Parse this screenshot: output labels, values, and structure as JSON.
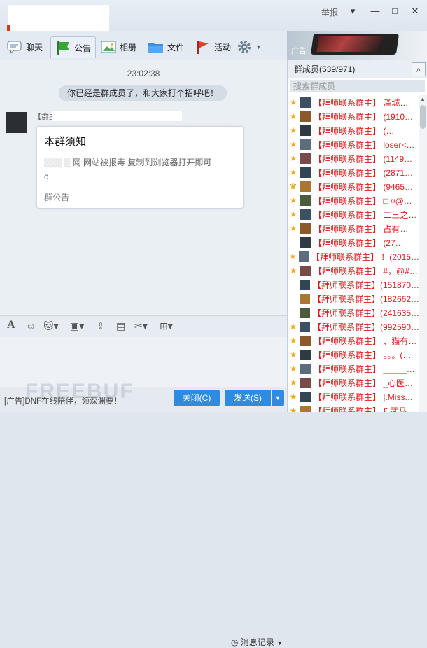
{
  "window": {
    "report_label": "举报",
    "controls": [
      "▾",
      "—",
      "□",
      "✕"
    ]
  },
  "tabs": [
    {
      "label": "聊天",
      "icon": "chat-bubble-icon"
    },
    {
      "label": "公告",
      "icon": "flag-icon",
      "active": true
    },
    {
      "label": "相册",
      "icon": "photo-icon"
    },
    {
      "label": "文件",
      "icon": "folder-icon"
    },
    {
      "label": "活动",
      "icon": "event-flag-icon"
    }
  ],
  "ad_top": {
    "label": "广告"
  },
  "chat": {
    "timestamp": "23:02:38",
    "system_message": "你已经是群成员了，和大家打个招呼吧！",
    "sender_prefix": "【群主",
    "card": {
      "title": "本群须知",
      "line1": "网 网站被报毒 复制到浏览器打开即可",
      "line2": "c              .com",
      "footer": "群公告"
    }
  },
  "input_toolbar": {
    "history_label": "消息记录"
  },
  "bottom": {
    "ad_text": "[广告]DNF在线陪伴，领深渊要！",
    "close_button": "关闭(C)",
    "send_button": "发送(S)"
  },
  "members": {
    "header": "群成员(539/971)",
    "search_placeholder": "搜索群成员",
    "items": [
      {
        "role": "star",
        "name": "【拜师联系群主】  泽城…"
      },
      {
        "role": "star",
        "name": "【拜师联系群主】  (1910…"
      },
      {
        "role": "star",
        "name": "【拜师联系群主】       (…"
      },
      {
        "role": "star",
        "name": "【拜师联系群主】  loser<…"
      },
      {
        "role": "star",
        "name": "【拜师联系群主】  (1149…"
      },
      {
        "role": "star",
        "name": "【拜师联系群主】  (2871…"
      },
      {
        "role": "crown",
        "name": "【拜师联系群主】  (9465…"
      },
      {
        "role": "star",
        "name": "【拜师联系群主】  □ ¤@…"
      },
      {
        "role": "star",
        "name": "【拜师联系群主】  二三之…"
      },
      {
        "role": "star",
        "name": "【拜师联系群主】   占有…"
      },
      {
        "role": "none",
        "name": "【拜师联系群主】     (27…"
      },
      {
        "role": "star",
        "name": "【拜师联系群主】  ！(2015…"
      },
      {
        "role": "star",
        "name": "【拜师联系群主】  #，@#…"
      },
      {
        "role": "none",
        "name": "【拜师联系群主】(151870…"
      },
      {
        "role": "none",
        "name": "【拜师联系群主】(182662…"
      },
      {
        "role": "none",
        "name": "【拜师联系群主】(241635…"
      },
      {
        "role": "star",
        "name": "【拜师联系群主】(992590…"
      },
      {
        "role": "star",
        "name": "【拜师联系群主】  、猫有…"
      },
      {
        "role": "star",
        "name": "【拜师联系群主】  。。。(…"
      },
      {
        "role": "star",
        "name": "【拜师联系群主】  _____…"
      },
      {
        "role": "star",
        "name": "【拜师联系群主】  _心医…"
      },
      {
        "role": "star",
        "name": "【拜师联系群主】  |.Miss.…"
      },
      {
        "role": "star",
        "name": "【拜师联系群主】    £ 武马…"
      }
    ]
  },
  "colors": {
    "accent": "#2e8be0",
    "member_name": "#d61e1e"
  }
}
